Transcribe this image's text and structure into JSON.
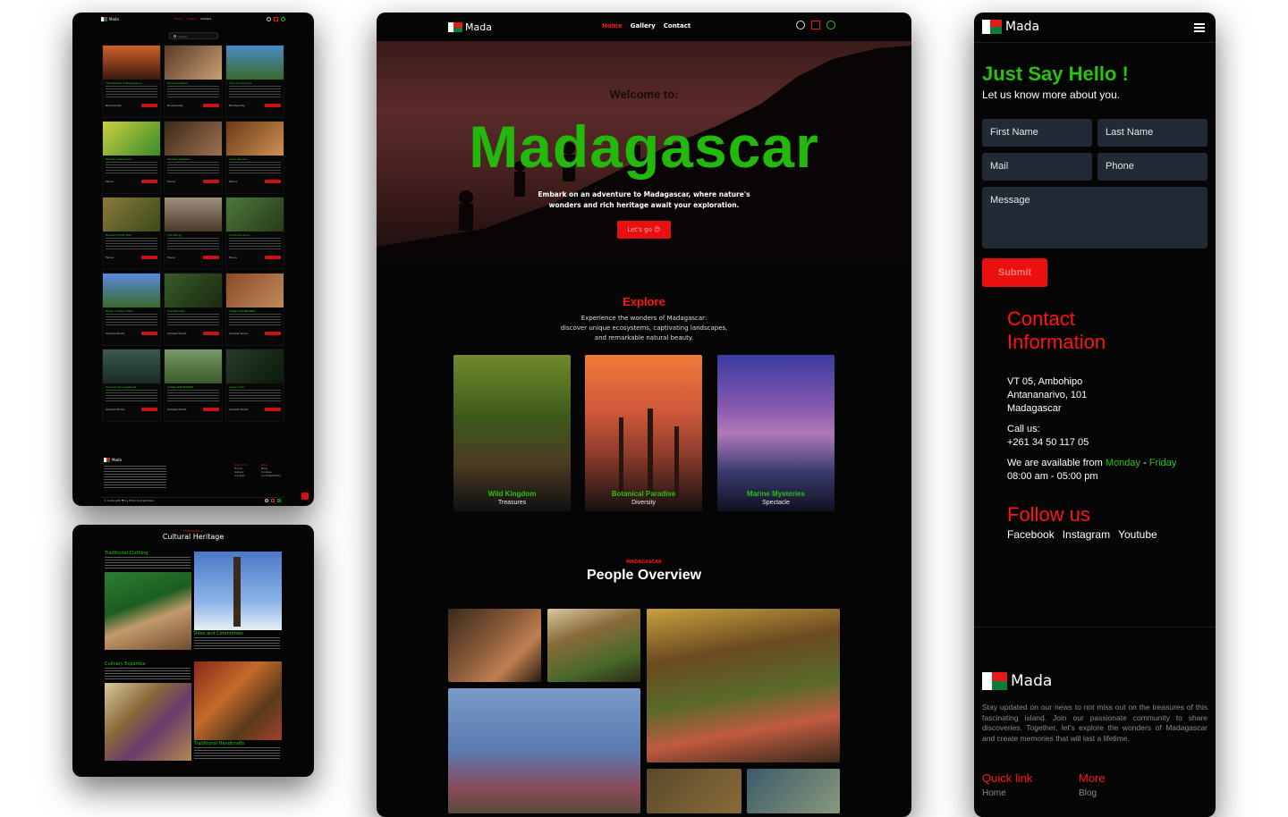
{
  "brand": {
    "name": "Mada"
  },
  "gallery_mock": {
    "nav": {
      "links": [
        "Home",
        "Gallery",
        "Contact"
      ]
    },
    "search_placeholder": "Search",
    "cards": [
      {
        "title": "The Baobab of Madagascar",
        "tag": "Biodiversity",
        "btn": "Learn More"
      },
      {
        "title": "Faces Sakalava",
        "tag": "Biodiversity",
        "btn": "Learn More"
      },
      {
        "title": "The rice terraces",
        "tag": "Biodiversity",
        "btn": "Learn More"
      },
      {
        "title": "Panther Chameleon",
        "tag": "Fauna",
        "btn": "Learn More"
      },
      {
        "title": "Women Sakalava",
        "tag": "Fauna",
        "btn": "Learn More"
      },
      {
        "title": "Local dancers",
        "tag": "Fauna",
        "btn": "Learn More"
      },
      {
        "title": "Baobab Forest Trail",
        "tag": "Fauna",
        "btn": "Learn More"
      },
      {
        "title": "The Tsingy",
        "tag": "Fauna",
        "btn": "Learn More"
      },
      {
        "title": "Crowned Lemur",
        "tag": "Fauna",
        "btn": "Learn More"
      },
      {
        "title": "Beach of Nosy Mitsio",
        "tag": "Sample Works",
        "btn": "Learn More"
      },
      {
        "title": "The Baobabs",
        "tag": "Sample Works",
        "btn": "Learn More"
      },
      {
        "title": "Village ZAFIMANIRY",
        "tag": "Sample Works",
        "btn": "Learn More"
      },
      {
        "title": "Discover the rainforest",
        "tag": "Sample Works",
        "btn": "Learn More"
      },
      {
        "title": "Village ZAFIMANIRY",
        "tag": "Sample Works",
        "btn": "Learn More"
      },
      {
        "title": "Lemur Indri",
        "tag": "Sample Works",
        "btn": "Learn More"
      }
    ],
    "footer": {
      "quick_link_title": "Quick link",
      "quick_links": [
        "Home",
        "Gallery",
        "Contact"
      ],
      "more_title": "More",
      "more_links": [
        "Blog",
        "Cookies",
        "Confidentiality"
      ],
      "credit": "© Code with ♥ by Eddy Andriambelo"
    }
  },
  "culture_mock": {
    "eyebrow": "MADAGASCAR",
    "title": "Cultural Heritage",
    "sections": [
      {
        "title": "Traditional Clothing"
      },
      {
        "title": "Rites and Ceremonies"
      },
      {
        "title": "Culinary Expertise"
      },
      {
        "title": "Traditional Handicrafts"
      }
    ]
  },
  "main_mock": {
    "nav": {
      "links": [
        "Home",
        "Gallery",
        "Contact"
      ],
      "active": "Home"
    },
    "hero": {
      "welcome": "Welcome to:",
      "title": "Madagascar",
      "subtitle_line1": "Embark on an adventure to Madagascar, where nature's",
      "subtitle_line2": "wonders and rich heritage await your exploration.",
      "cta": "Let's go 😊"
    },
    "explore": {
      "title": "Explore",
      "text_line1": "Experience the wonders of Madagascar:",
      "text_line2": "discover unique ecosystems, captivating landscapes,",
      "text_line3": "and remarkable natural beauty.",
      "cards": [
        {
          "title": "Wild Kingdom",
          "sub": "Treasures"
        },
        {
          "title": "Botanical Paradise",
          "sub": "Diversity"
        },
        {
          "title": "Marine Mysteries",
          "sub": "Spectacle"
        }
      ]
    },
    "people": {
      "eyebrow": "MADAGASCAR",
      "title": "People Overview"
    }
  },
  "contact_mock": {
    "heading": "Just Say Hello !",
    "subheading": "Let us know more about you.",
    "form": {
      "first_name": "First Name",
      "last_name": "Last Name",
      "mail": "Mail",
      "phone": "Phone",
      "message": "Message",
      "submit": "Submit"
    },
    "info": {
      "title_line1": "Contact",
      "title_line2": "Information",
      "address_line1": "VT 05, Ambohipo",
      "address_line2": "Antananarivo, 101",
      "address_line3": "Madagascar",
      "call_label": "Call us:",
      "phone": "+261 34 50 117 05",
      "avail_prefix": "We are available from",
      "day_from": "Monday",
      "day_sep": "-",
      "day_to": "Friday",
      "hours": "08:00 am - 05:00 pm"
    },
    "follow": {
      "title": "Follow us",
      "links": [
        "Facebook",
        "Instagram",
        "Youtube"
      ]
    },
    "footer": {
      "text": "Stay updated on our news to not miss out on the treasures of this fascinating island. Join our passionate community to share discoveries. Together, let's explore the wonders of Madagascar and create memories that will last a lifetime.",
      "quick_link": "Quick link",
      "more": "More",
      "home": "Home",
      "blog": "Blog"
    }
  },
  "colors": {
    "green": "#28c40a",
    "red": "#ff1414",
    "bg": "#050505",
    "field": "#222a36"
  }
}
